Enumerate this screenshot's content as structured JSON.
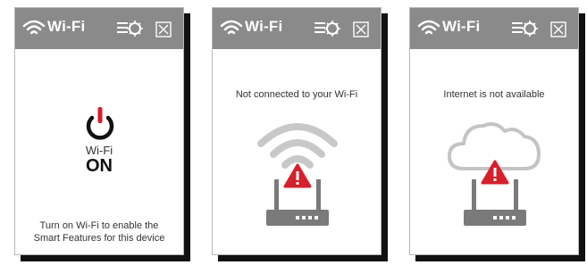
{
  "panels": [
    {
      "title": "Wi-Fi",
      "wifi_label": "Wi-Fi",
      "status": "ON",
      "message": "Turn on Wi-Fi to enable the Smart Features for this device"
    },
    {
      "title": "Wi-Fi",
      "message": "Not connected to your Wi-Fi"
    },
    {
      "title": "Wi-Fi",
      "message": "Internet is not available"
    }
  ],
  "colors": {
    "titlebar": "#8a8a8a",
    "accent_red": "#d6202b",
    "icon_gray": "#7a7a7a",
    "light_gray": "#bdbdbd"
  },
  "icons": [
    "wifi-icon",
    "settings-menu-icon",
    "close-icon",
    "power-icon",
    "router-icon",
    "warning-icon",
    "cloud-icon"
  ]
}
